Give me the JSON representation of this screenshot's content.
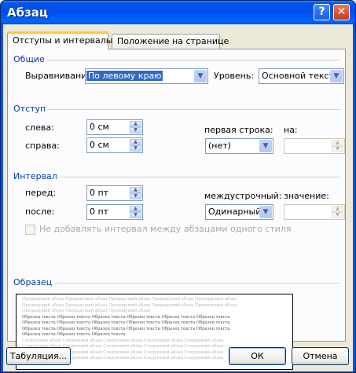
{
  "window": {
    "title": "Абзац"
  },
  "title_buttons": {
    "help": "?",
    "close": "✕"
  },
  "tabs": [
    {
      "label": "Отступы и интервалы"
    },
    {
      "label": "Положение на странице"
    }
  ],
  "general": {
    "heading": "Общие",
    "alignment_label": "Выравнивание:",
    "alignment_value": "По левому краю",
    "level_label": "Уровень:",
    "level_value": "Основной текст"
  },
  "indent": {
    "heading": "Отступ",
    "left_label": "слева:",
    "left_value": "0 см",
    "right_label": "справа:",
    "right_value": "0 см",
    "first_line_label": "первая строка:",
    "first_line_value": "(нет)",
    "by_label": "на:",
    "by_value": ""
  },
  "spacing": {
    "heading": "Интервал",
    "before_label": "перед:",
    "before_value": "0 пт",
    "after_label": "после:",
    "after_value": "0 пт",
    "line_label": "междустрочный:",
    "line_value": "Одинарный",
    "at_label": "значение:",
    "at_value": "",
    "no_space_label": "Не добавлять интервал между абзацами одного стиля"
  },
  "preview": {
    "heading": "Образец",
    "lines": [
      {
        "kind": "prev",
        "text": "Предыдущий абзац Предыдущий абзац Предыдущий абзац Предыдущий абзац Предыдущий абзац"
      },
      {
        "kind": "prev",
        "text": "Предыдущий абзац Предыдущий абзац Предыдущий абзац Предыдущий абзац Предыдущий абзац"
      },
      {
        "kind": "prev",
        "text": "Предыдущий абзац Предыдущий абзац Предыдущий абзац"
      },
      {
        "kind": "sample",
        "text": "Образец текста Образец текста Образец текста Образец текста Образец текста Образец текста"
      },
      {
        "kind": "sample",
        "text": "Образец текста Образец текста Образец текста Образец текста Образец текста Образец текста"
      },
      {
        "kind": "sample",
        "text": "Образец текста Образец текста Образец текста Образец текста Образец текста Образец текста"
      },
      {
        "kind": "sample",
        "text": "Образец текста Образец текста Образец текста"
      },
      {
        "kind": "next",
        "text": "Следующий абзац Следующий абзац Следующий абзац Следующий абзац Следующий абзац"
      },
      {
        "kind": "next",
        "text": "Следующий абзац Следующий абзац Следующий абзац Следующий абзац Следующий абзац"
      },
      {
        "kind": "next",
        "text": "Следующий абзац Следующий абзац Следующий абзац Следующий абзац Следующий абзац"
      },
      {
        "kind": "next",
        "text": "Следующий абзац Следующий абзац Следующий абзац Следующий абзац Следующий абзац"
      }
    ]
  },
  "buttons": {
    "tabs": "Табуляция...",
    "ok": "ОК",
    "cancel": "Отмена"
  },
  "colors": {
    "titlebar": "#0054e3",
    "group_heading": "#003ca5",
    "face": "#ece9d8"
  }
}
